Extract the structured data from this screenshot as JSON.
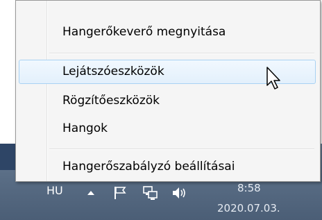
{
  "menu": {
    "items": [
      {
        "label": "Hangerőkeverő megnyitása"
      },
      {
        "label": "Lejátszóeszközök"
      },
      {
        "label": "Rögzítőeszközök"
      },
      {
        "label": "Hangok"
      },
      {
        "label": "Hangerőszabályzó beállításai"
      }
    ]
  },
  "tray": {
    "language": "HU",
    "icons": [
      "show-hidden-icons-icon",
      "action-center-flag-icon",
      "network-icon",
      "speaker-icon"
    ],
    "clock_time": "8:58",
    "clock_date": "2020.07.03."
  },
  "colors": {
    "menu_bg": "#f5f5f5",
    "hover_border": "#a8d2f3",
    "taskbar": "#5a6e86"
  }
}
